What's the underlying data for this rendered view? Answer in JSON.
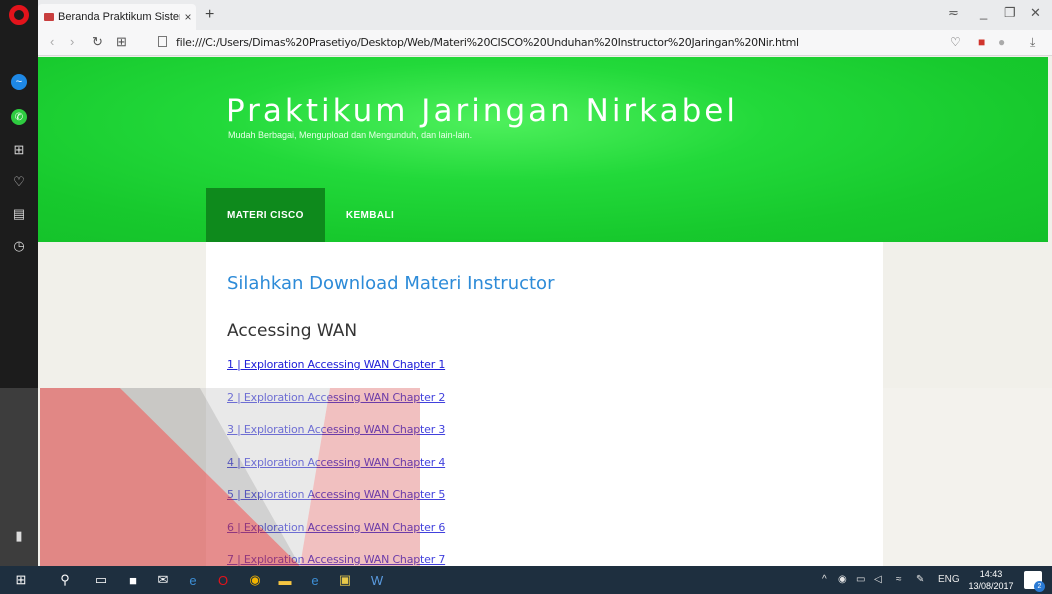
{
  "browser": {
    "tab_title": "Beranda Praktikum Sistem",
    "tab_close": "×",
    "new_tab": "+",
    "url": "file:///C:/Users/Dimas%20Prasetiyo/Desktop/Web/Materi%20CISCO%20Unduhan%20Instructor%20Jaringan%20Nir.html"
  },
  "site": {
    "title": "Praktikum Jaringan Nirkabel",
    "subtitle": "Mudah Berbagai, Mengupload dan Mengunduh, dan lain-lain."
  },
  "menu": [
    {
      "label": "MATERI CISCO"
    },
    {
      "label": "KEMBALI"
    }
  ],
  "content": {
    "heading": "Silahkan Download Materi Instructor",
    "section": "Accessing WAN",
    "links": [
      "1 | Exploration Accessing WAN Chapter 1",
      "2 | Exploration Accessing WAN Chapter 2",
      "3 | Exploration Accessing WAN Chapter 3",
      "4 | Exploration Accessing WAN Chapter 4",
      "5 | Exploration Accessing WAN Chapter 5",
      "6 | Exploration Accessing WAN Chapter 6",
      "7 | Exploration Accessing WAN Chapter 7"
    ]
  },
  "taskbar": {
    "lang": "ENG",
    "time": "14:43",
    "date": "13/08/2017",
    "notifications": "2"
  },
  "colors": {
    "hero_green": "#17c92d",
    "menu_active": "#0e8a1c",
    "heading_blue": "#2d8bd8",
    "link": "#2020d8"
  }
}
